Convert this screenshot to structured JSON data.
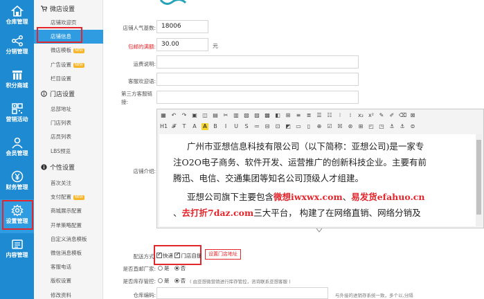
{
  "rail": [
    {
      "label": "仓库管理",
      "icon": "home-icon"
    },
    {
      "label": "分销管理",
      "icon": "share-icon"
    },
    {
      "label": "积分商城",
      "icon": "store-icon"
    },
    {
      "label": "营销活动",
      "icon": "qrcode-icon"
    },
    {
      "label": "会员管理",
      "icon": "user-icon"
    },
    {
      "label": "财务管理",
      "icon": "yen-icon"
    },
    {
      "label": "设置管理",
      "icon": "gear-icon"
    },
    {
      "label": "内容管理",
      "icon": "content-icon"
    }
  ],
  "submenu": {
    "group1": "微店设置",
    "group1_items": [
      "店铺欢迎页",
      "店铺信息",
      "微店模板",
      "广告设置",
      "栏目设置"
    ],
    "group2": "门店设置",
    "group2_items": [
      "总部地址",
      "门店列表",
      "店员列表",
      "LBS预览"
    ],
    "group3": "个性设置",
    "group3_items": [
      "首次关注",
      "支付配置",
      "商城展示配置",
      "开单策略配置",
      "自定义消息模板",
      "微信消息模板",
      "客服电话",
      "版权设置",
      "修改资料"
    ],
    "hot_label": "NEW"
  },
  "form": {
    "popularity_label": "店铺人气基数:",
    "popularity_value": "18006",
    "free_shipping_label": "包邮的满额:",
    "free_shipping_value": "30.00",
    "free_shipping_unit": "元",
    "shipping_desc_label": "运费说明:",
    "cs_welcome_label": "客服欢迎语:",
    "third_party_label_1": "第三方客服链",
    "third_party_label_2": "接:",
    "intro_label": "店铺介绍:",
    "delivery_label": "配送方式:",
    "delivery_express": "快递",
    "delivery_pickup": "门店自提",
    "set_store_button": "设置门店地址",
    "direct_mail_label": "是否直邮厂家:",
    "direct_yes": "是",
    "direct_no": "否",
    "stock_label": "是否库存管控:",
    "stock_yes": "是",
    "stock_no": "否",
    "stock_hint": "( 由亚想微营销进行库存管控，咨询联系亚想客服 )",
    "warehouse_label": "仓库编码:",
    "warehouse_hint": "与外接的进销存系统一致，多个以,分隔"
  },
  "editor": {
    "paragraphs": [
      {
        "parts": [
          {
            "t": "广州市亚想信息科技有限公司（以下简称：亚想公司)是一家专",
            "c": "#222"
          }
        ]
      },
      {
        "parts": [
          {
            "t": "注O2O电子商务、软件开发、运营推广的创新科技企业。主要有前",
            "c": "#222"
          }
        ]
      },
      {
        "parts": [
          {
            "t": "腾迅、电信、交通集团等知名公司顶级人才组建。",
            "c": "#222"
          }
        ]
      },
      {
        "parts": [
          {
            "t": "亚想公司旗下主要包含",
            "c": "#222"
          },
          {
            "t": "微想iwxwx.com",
            "c": "#e3262c",
            "b": true
          },
          {
            "t": "、",
            "c": "#222"
          },
          {
            "t": "易发货efahuo.cn",
            "c": "#e3262c",
            "b": true
          }
        ]
      },
      {
        "parts": [
          {
            "t": "、",
            "c": "#222"
          },
          {
            "t": "去打折7daz.com",
            "c": "#e3262c",
            "b": true
          },
          {
            "t": "三大平台，  构建了在网络直销、网络分销及",
            "c": "#222"
          }
        ]
      }
    ]
  },
  "colors": {
    "rail": "#1d8ad2",
    "accent": "#2f9be0",
    "highlight": "#e3262c"
  }
}
